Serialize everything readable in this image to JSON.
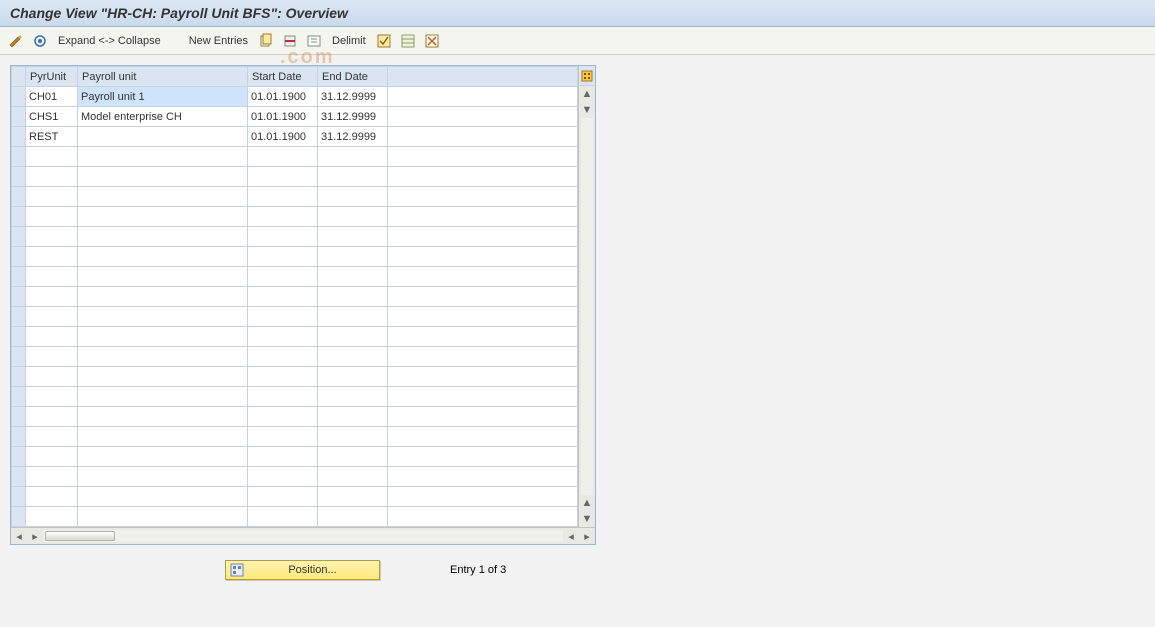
{
  "title": "Change View \"HR-CH: Payroll Unit BFS\": Overview",
  "toolbar": {
    "expand": "Expand <-> Collapse",
    "newEntries": "New Entries",
    "delimit": "Delimit"
  },
  "table": {
    "columns": {
      "pyrunit": "PyrUnit",
      "payroll": "Payroll unit",
      "start": "Start Date",
      "end": "End Date"
    },
    "rows": [
      {
        "pyrunit": "CH01",
        "payroll": "Payroll unit 1",
        "start": "01.01.1900",
        "end": "31.12.9999",
        "selected": true
      },
      {
        "pyrunit": "CHS1",
        "payroll": "Model enterprise CH",
        "start": "01.01.1900",
        "end": "31.12.9999",
        "selected": false
      },
      {
        "pyrunit": "REST",
        "payroll": "",
        "start": "01.01.1900",
        "end": "31.12.9999",
        "selected": false
      }
    ],
    "emptyRows": 19
  },
  "footer": {
    "positionBtn": "Position...",
    "entryStatus": "Entry 1 of 3"
  },
  "watermark": ".com"
}
